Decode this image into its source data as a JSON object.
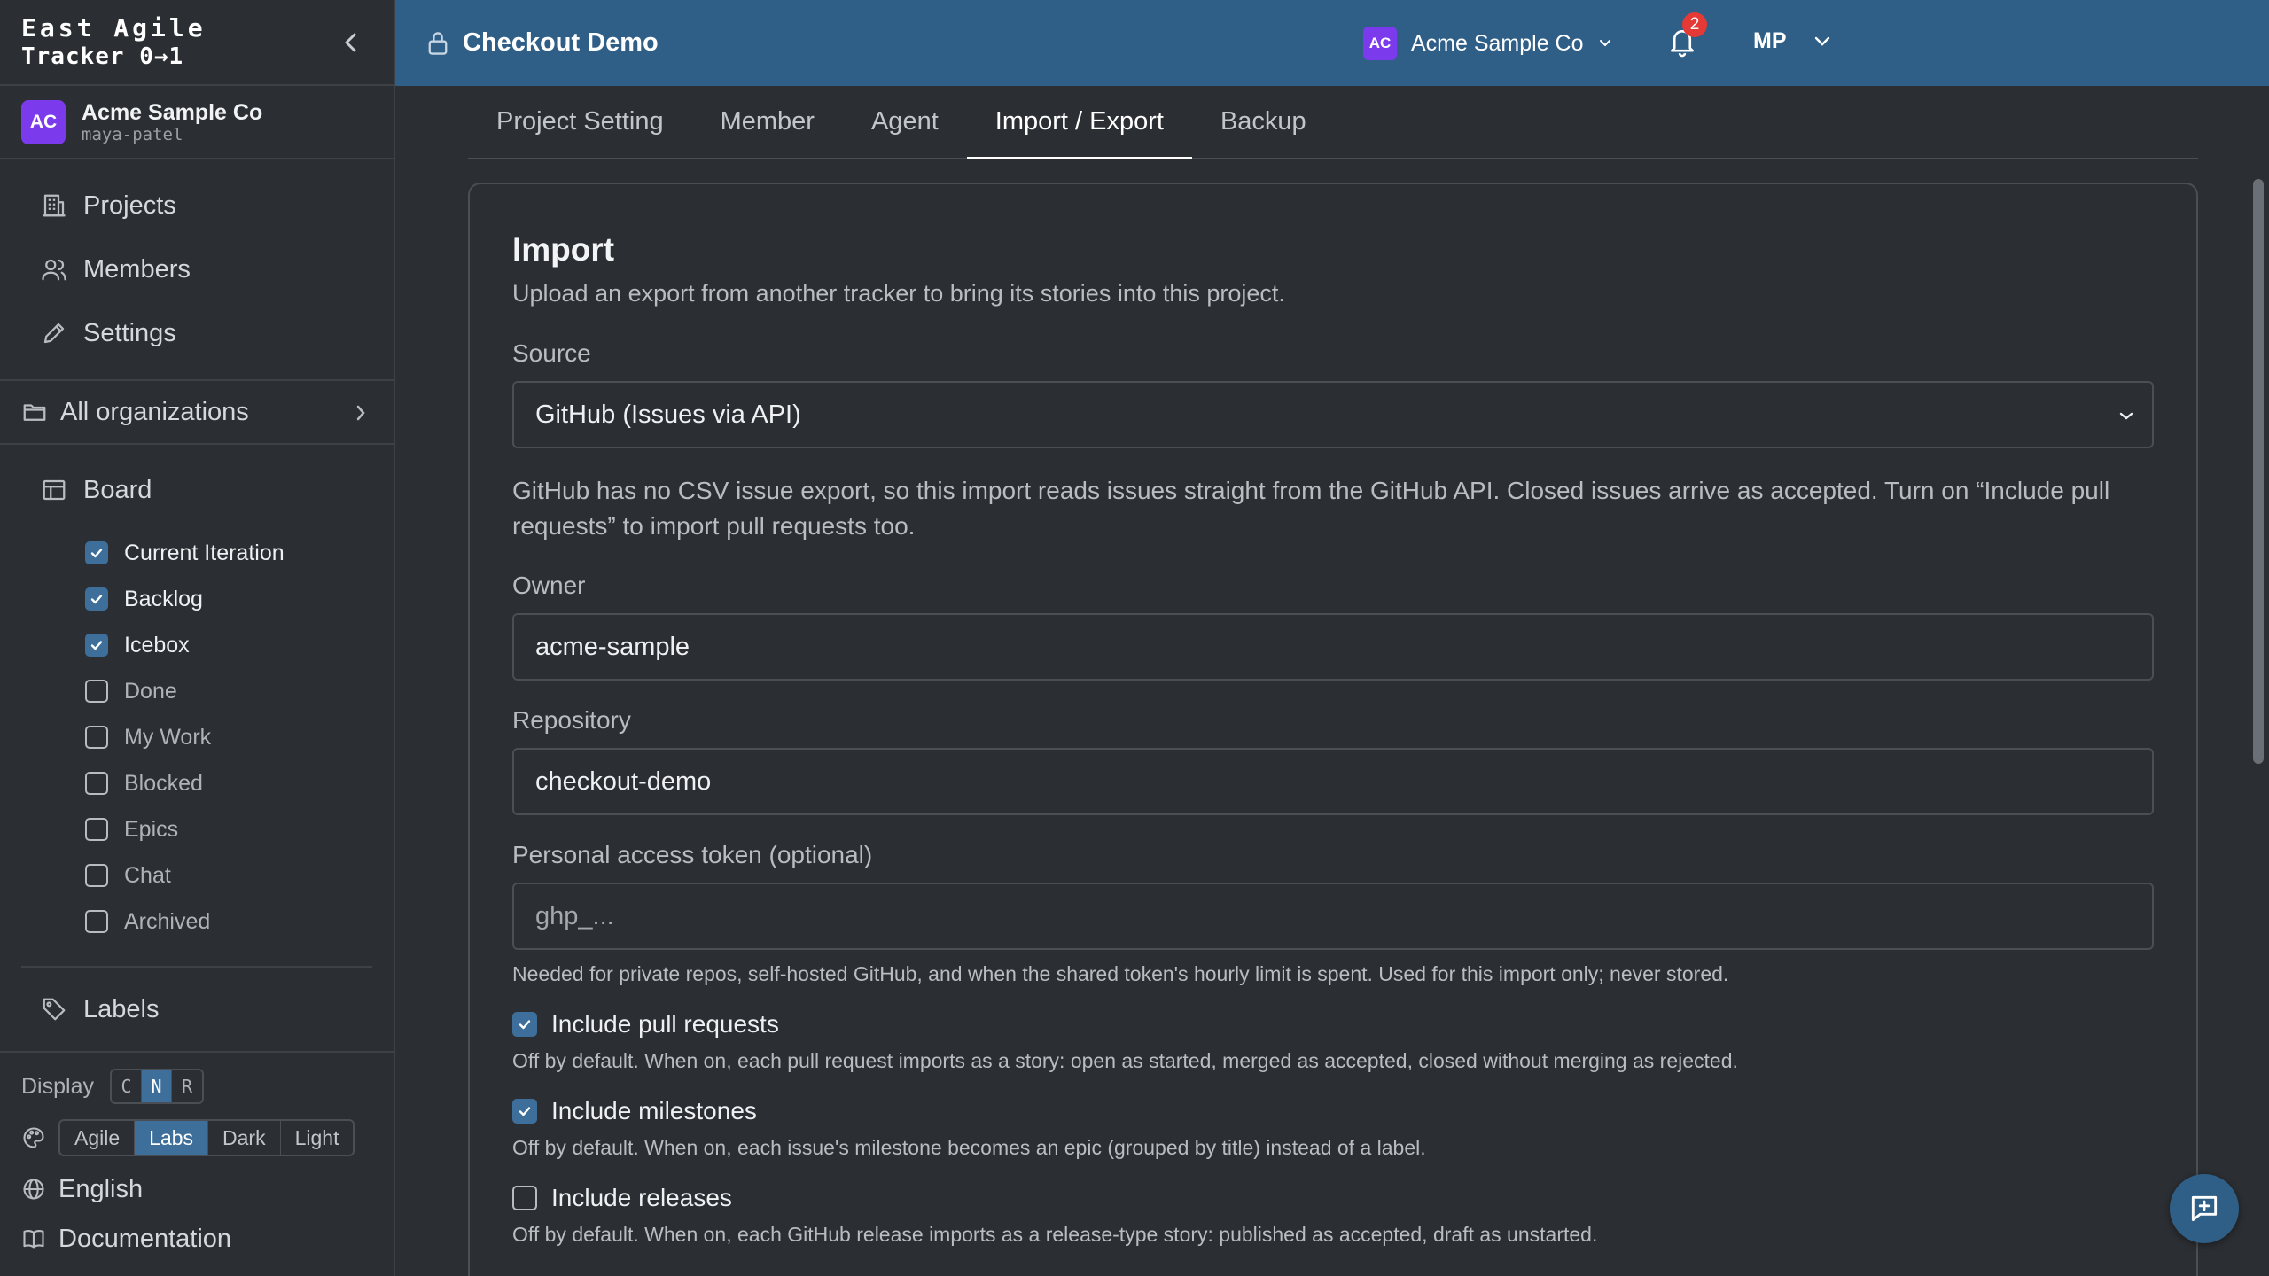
{
  "brand": {
    "line1": "East Agile",
    "line2": "Tracker 0→1"
  },
  "org": {
    "initials": "AC",
    "name": "Acme Sample Co",
    "user": "maya-patel"
  },
  "nav": [
    {
      "label": "Projects",
      "icon": "building-icon"
    },
    {
      "label": "Members",
      "icon": "users-icon"
    },
    {
      "label": "Settings",
      "icon": "pencil-icon"
    }
  ],
  "all_orgs": "All organizations",
  "board": {
    "label": "Board",
    "panels": [
      {
        "label": "Current Iteration",
        "checked": true
      },
      {
        "label": "Backlog",
        "checked": true
      },
      {
        "label": "Icebox",
        "checked": true
      },
      {
        "label": "Done",
        "checked": false
      },
      {
        "label": "My Work",
        "checked": false
      },
      {
        "label": "Blocked",
        "checked": false
      },
      {
        "label": "Epics",
        "checked": false
      },
      {
        "label": "Chat",
        "checked": false
      },
      {
        "label": "Archived",
        "checked": false
      }
    ]
  },
  "labels": "Labels",
  "display": {
    "label": "Display",
    "options": [
      "C",
      "N",
      "R"
    ],
    "selected": "N"
  },
  "theme": {
    "options": [
      "Agile",
      "Labs",
      "Dark",
      "Light"
    ],
    "selected": "Labs"
  },
  "language": "English",
  "docs": "Documentation",
  "topbar": {
    "project": "Checkout Demo",
    "org_initials": "AC",
    "org_name": "Acme Sample Co",
    "notifications": "2",
    "user_initials": "MP"
  },
  "tabs": [
    {
      "label": "Project Setting",
      "active": false
    },
    {
      "label": "Member",
      "active": false
    },
    {
      "label": "Agent",
      "active": false
    },
    {
      "label": "Import / Export",
      "active": true
    },
    {
      "label": "Backup",
      "active": false
    }
  ],
  "import": {
    "title": "Import",
    "subtitle": "Upload an export from another tracker to bring its stories into this project.",
    "source_label": "Source",
    "source_value": "GitHub (Issues via API)",
    "info": "GitHub has no CSV issue export, so this import reads issues straight from the GitHub API. Closed issues arrive as accepted. Turn on “Include pull requests” to import pull requests too.",
    "owner_label": "Owner",
    "owner_value": "acme-sample",
    "repo_label": "Repository",
    "repo_value": "checkout-demo",
    "token_label": "Personal access token (optional)",
    "token_placeholder": "ghp_...",
    "token_hint": "Needed for private repos, self-hosted GitHub, and when the shared token's hourly limit is spent. Used for this import only; never stored.",
    "options": [
      {
        "label": "Include pull requests",
        "checked": true,
        "desc": "Off by default. When on, each pull request imports as a story: open as started, merged as accepted, closed without merging as rejected."
      },
      {
        "label": "Include milestones",
        "checked": true,
        "desc": "Off by default. When on, each issue's milestone becomes an epic (grouped by title) instead of a label."
      },
      {
        "label": "Include releases",
        "checked": false,
        "desc": "Off by default. When on, each GitHub release imports as a release-type story: published as accepted, draft as unstarted."
      }
    ]
  },
  "colors": {
    "accent": "#3d6f9a",
    "topbar": "#2f5f87",
    "avatar": "#7c3aed",
    "badge": "#e53935"
  }
}
